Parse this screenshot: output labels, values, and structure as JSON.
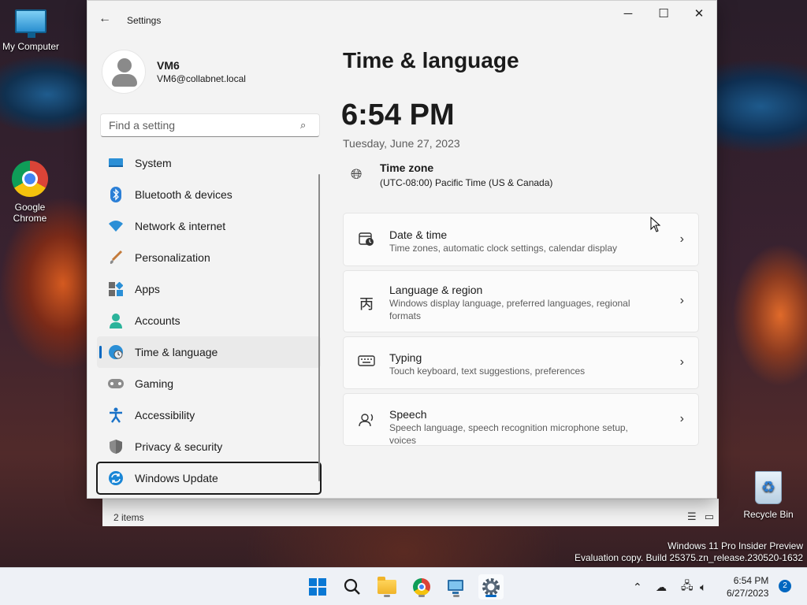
{
  "desktop": {
    "icons": [
      {
        "label": "My Computer"
      },
      {
        "label": "Google Chrome"
      },
      {
        "label": "Recycle Bin"
      }
    ],
    "watermark_line1": "Windows 11 Pro Insider Preview",
    "watermark_line2": "Evaluation copy. Build 25375.zn_release.230520-1632"
  },
  "explorer": {
    "status": "2 items"
  },
  "settings": {
    "window_title": "Settings",
    "user": {
      "name": "VM6",
      "email": "VM6@collabnet.local"
    },
    "search_placeholder": "Find a setting",
    "nav": [
      {
        "label": "System",
        "icon": "monitor-icon"
      },
      {
        "label": "Bluetooth & devices",
        "icon": "bluetooth-icon"
      },
      {
        "label": "Network & internet",
        "icon": "wifi-icon"
      },
      {
        "label": "Personalization",
        "icon": "brush-icon"
      },
      {
        "label": "Apps",
        "icon": "apps-icon"
      },
      {
        "label": "Accounts",
        "icon": "person-icon"
      },
      {
        "label": "Time & language",
        "icon": "globe-clock-icon",
        "active": true
      },
      {
        "label": "Gaming",
        "icon": "gamepad-icon"
      },
      {
        "label": "Accessibility",
        "icon": "accessibility-icon"
      },
      {
        "label": "Privacy & security",
        "icon": "shield-icon"
      },
      {
        "label": "Windows Update",
        "icon": "update-icon",
        "focused": true
      }
    ],
    "page_title": "Time & language",
    "time": "6:54 PM",
    "date": "Tuesday, June 27, 2023",
    "timezone": {
      "label": "Time zone",
      "value": "(UTC-08:00) Pacific Time (US & Canada)"
    },
    "cards": [
      {
        "title": "Date & time",
        "desc": "Time zones, automatic clock settings, calendar display",
        "icon": "calendar-clock-icon"
      },
      {
        "title": "Language & region",
        "desc": "Windows display language, preferred languages, regional formats",
        "icon": "language-icon"
      },
      {
        "title": "Typing",
        "desc": "Touch keyboard, text suggestions, preferences",
        "icon": "keyboard-icon"
      },
      {
        "title": "Speech",
        "desc": "Speech language, speech recognition microphone setup, voices",
        "icon": "speech-icon"
      }
    ]
  },
  "taskbar": {
    "time": "6:54 PM",
    "date": "6/27/2023",
    "notification_count": "2"
  },
  "colors": {
    "accent": "#0067c0",
    "window_bg": "#f3f3f3",
    "card_bg": "#fbfbfb"
  }
}
